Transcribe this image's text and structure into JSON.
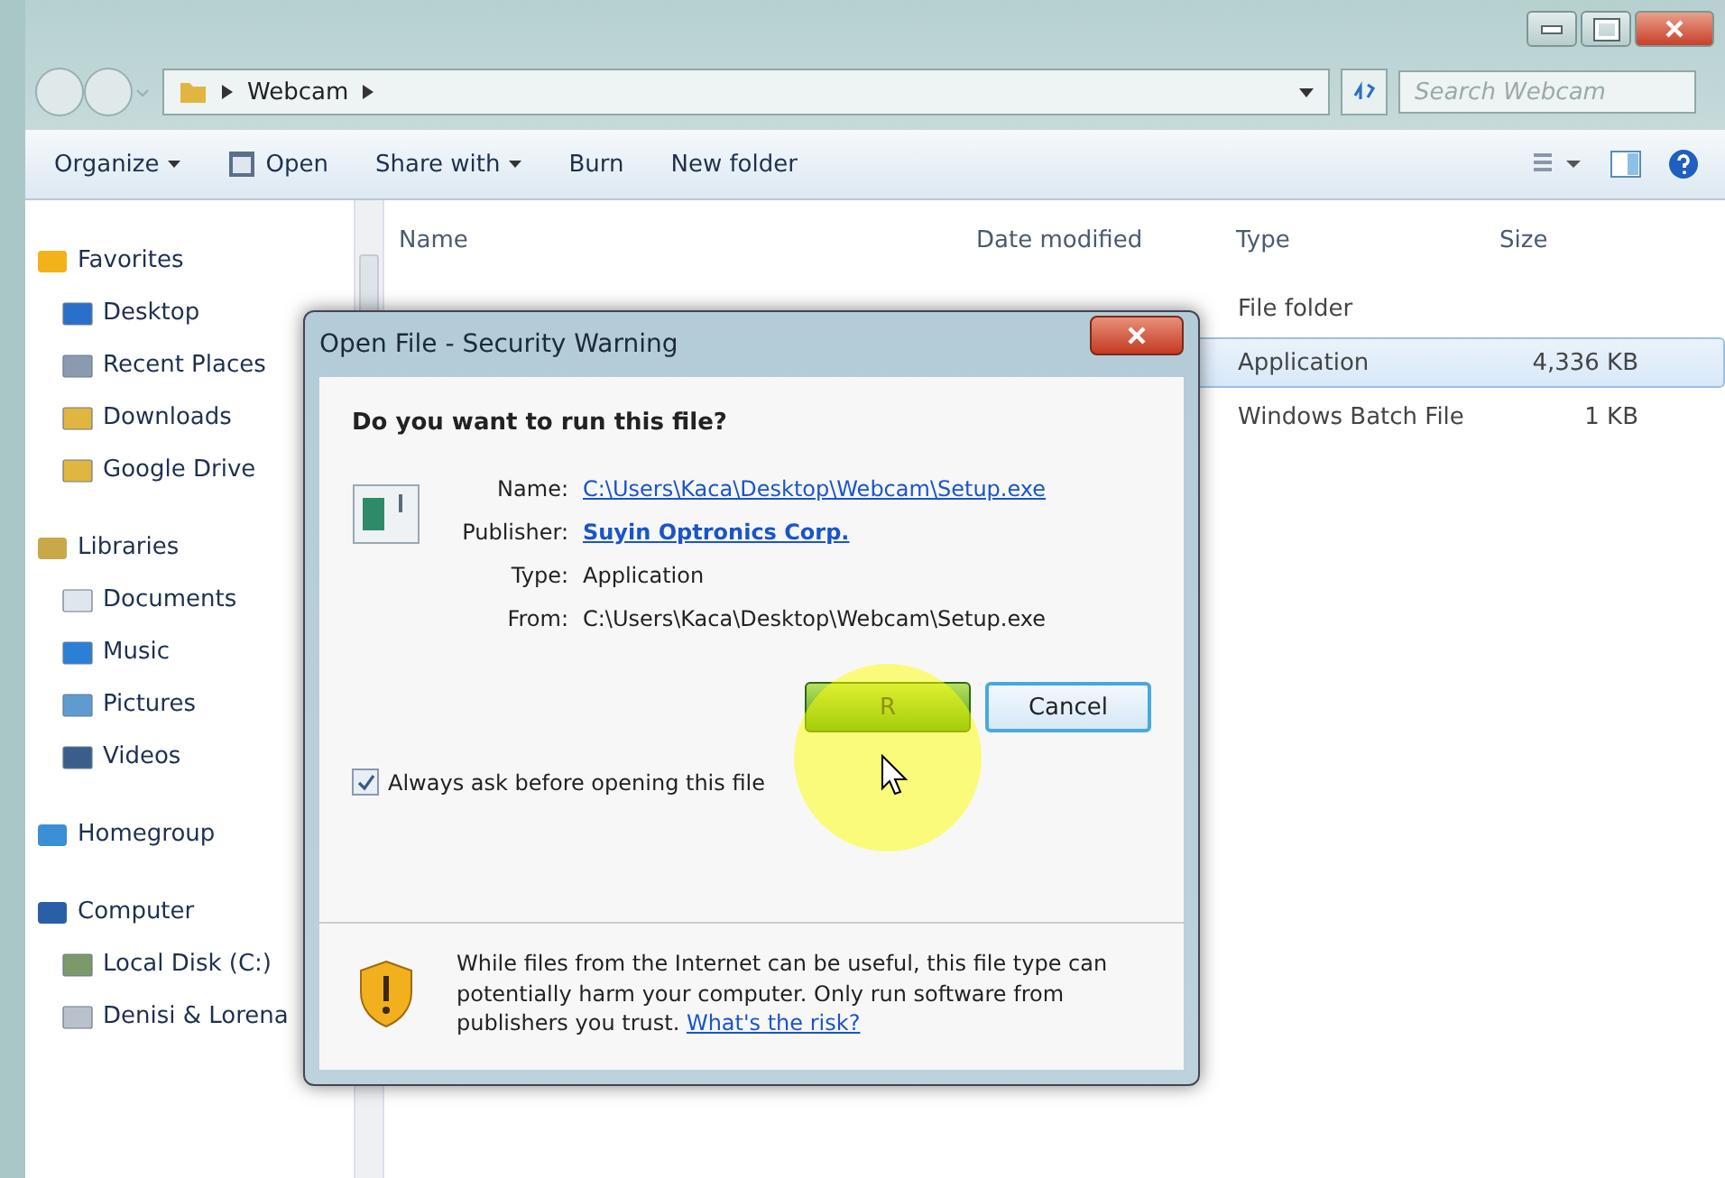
{
  "window": {
    "breadcrumb": "Webcam",
    "search": {
      "placeholder": "Search Webcam"
    }
  },
  "toolbar": [
    {
      "label": "Organize",
      "kind": "menu"
    },
    {
      "label": "Open",
      "kind": "icon"
    },
    {
      "label": "Share with",
      "kind": "menu"
    },
    {
      "label": "Burn",
      "kind": "plain"
    },
    {
      "label": "New folder",
      "kind": "plain"
    }
  ],
  "sidebar": {
    "groups": [
      {
        "label": "Favorites",
        "children": [
          {
            "label": "Desktop"
          },
          {
            "label": "Recent Places"
          },
          {
            "label": "Downloads"
          },
          {
            "label": "Google Drive"
          }
        ]
      },
      {
        "label": "Libraries",
        "children": [
          {
            "label": "Documents"
          },
          {
            "label": "Music"
          },
          {
            "label": "Pictures"
          },
          {
            "label": "Videos"
          }
        ]
      },
      {
        "label": "Homegroup"
      },
      {
        "label": "Computer",
        "children": [
          {
            "label": "Local Disk (C:)"
          },
          {
            "label": "Denisi & Lorena"
          }
        ]
      }
    ]
  },
  "table": {
    "columns": [
      "Name",
      "Date modified",
      "Type",
      "Size"
    ],
    "rows": [
      {
        "type": "File folder",
        "selected": false
      },
      {
        "type": "Application",
        "size": "4,336 KB",
        "selected": true
      },
      {
        "type": "Windows Batch File",
        "size": "1 KB",
        "selected": false
      }
    ]
  },
  "dialog": {
    "title": "Open File - Security Warning",
    "question": "Do you want to run this file?",
    "fields": [
      {
        "label": "Name:",
        "value": "C:\\Users\\Kaca\\Desktop\\Webcam\\Setup.exe",
        "kind": "link"
      },
      {
        "label": "Publisher:",
        "value": "Suyin Optronics Corp.",
        "kind": "strong-link"
      },
      {
        "label": "Type:",
        "value": "Application",
        "kind": "text"
      },
      {
        "label": "From:",
        "value": "C:\\Users\\Kaca\\Desktop\\Webcam\\Setup.exe",
        "kind": "text"
      }
    ],
    "buttons": [
      {
        "label": "R",
        "kind": "primary"
      },
      {
        "label": "Cancel",
        "kind": "default"
      }
    ],
    "checkbox": {
      "label": "Always ask before opening this file",
      "checked": true
    },
    "warning": {
      "text": "While files from the Internet can be useful, this file type can potentially harm your computer. Only run software from publishers you trust.",
      "link": "What's the risk?"
    }
  }
}
